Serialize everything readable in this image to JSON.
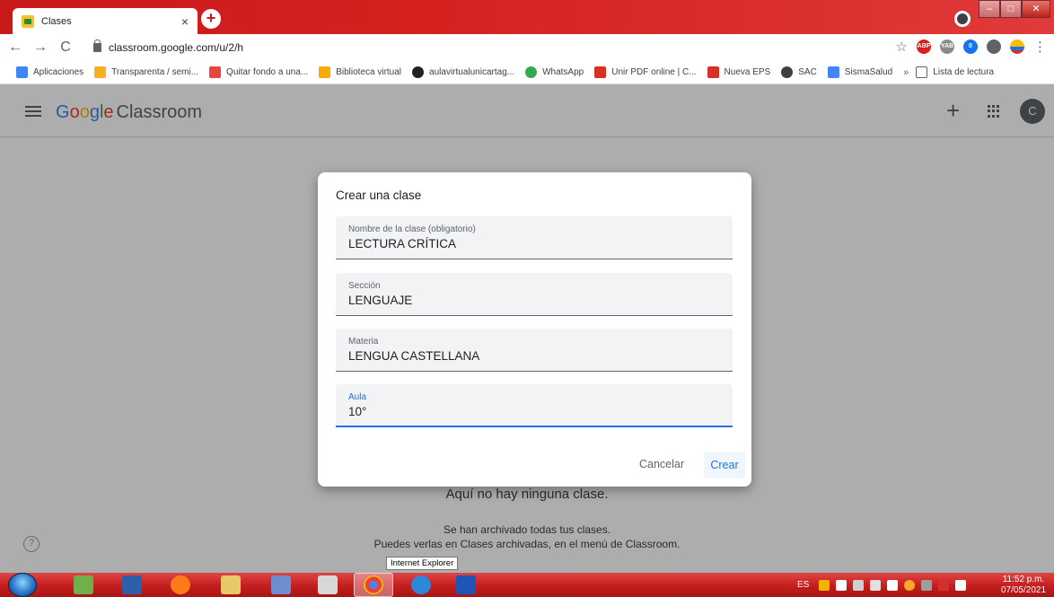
{
  "browser": {
    "tab_title": "Clases",
    "tab_close": "×",
    "new_tab": "+",
    "url": "classroom.google.com/u/2/h",
    "back": "←",
    "forward": "→",
    "reload": "C",
    "star": "☆",
    "extensions": [
      {
        "name": "abp",
        "text": "ABP",
        "color": "#d9201f"
      },
      {
        "name": "extension-gray",
        "text": "YAB",
        "color": "#8a8a8a"
      },
      {
        "name": "extension-badge",
        "text": "0",
        "color": "#1a73e8"
      },
      {
        "name": "puzzle",
        "text": "",
        "color": "#5f6368"
      },
      {
        "name": "profile-flag",
        "text": "",
        "color": "#fbbc05"
      }
    ],
    "menu": "⋮"
  },
  "bookmarks": {
    "items": [
      {
        "label": "Aplicaciones",
        "color": "#4285f4"
      },
      {
        "label": "Transparenta / semi...",
        "color": "#f6b026"
      },
      {
        "label": "Quitar fondo a una...",
        "color": "#e8453c"
      },
      {
        "label": "Biblioteca virtual",
        "color": "#f9ab00"
      },
      {
        "label": "aulavirtualunicartag...",
        "color": "#202124"
      },
      {
        "label": "WhatsApp",
        "color": "#34a853"
      },
      {
        "label": "Unir PDF online | C...",
        "color": "#d93025"
      },
      {
        "label": "Nueva EPS",
        "color": "#d93025"
      },
      {
        "label": "SAC",
        "color": "#3c4043"
      },
      {
        "label": "SismaSalud",
        "color": "#4285f4"
      }
    ],
    "more": "»",
    "reading_list": "Lista de lectura"
  },
  "classroom": {
    "brand_rest": "Classroom",
    "header_plus": "+",
    "avatar_letter": "C",
    "empty_title": "Aquí no hay ninguna clase.",
    "empty_line1": "Se han archivado todas tus clases.",
    "empty_line2": "Puedes verlas en Clases archivadas, en el menú de Classroom.",
    "help": "?"
  },
  "dialog": {
    "title": "Crear una clase",
    "fields": [
      {
        "label": "Nombre de la clase (obligatorio)",
        "value": "LECTURA CRÍTICA"
      },
      {
        "label": "Sección",
        "value": "LENGUAJE"
      },
      {
        "label": "Materia",
        "value": "LENGUA CASTELLANA"
      },
      {
        "label": "Aula",
        "value": "10°"
      }
    ],
    "cancel": "Cancelar",
    "create": "Crear"
  },
  "tooltip": "Internet Explorer",
  "taskbar": {
    "language": "ES",
    "time": "11:52 p.m.",
    "date": "07/05/2021"
  }
}
